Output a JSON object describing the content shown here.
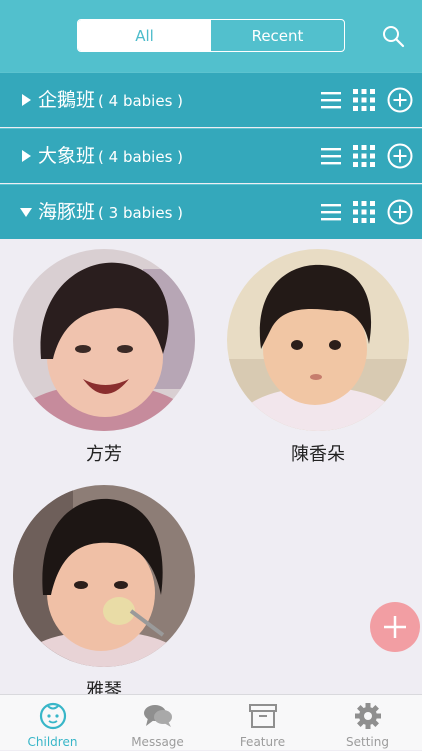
{
  "header": {
    "segments": {
      "all": "All",
      "recent": "Recent"
    },
    "active_segment": "All"
  },
  "groups": [
    {
      "name": "企鵝班",
      "count": "( 4 babies )",
      "expanded": false
    },
    {
      "name": "大象班",
      "count": "( 4 babies )",
      "expanded": false
    },
    {
      "name": "海豚班",
      "count": "( 3 babies )",
      "expanded": true
    }
  ],
  "children": [
    {
      "name": "方芳"
    },
    {
      "name": "陳香朵"
    },
    {
      "name": "雅琴"
    }
  ],
  "tabbar": {
    "children": "Children",
    "message": "Message",
    "feature": "Feature",
    "setting": "Setting",
    "active": "Children"
  },
  "colors": {
    "header": "#52c0cd",
    "group_row": "#34a8bb",
    "accent": "#38b6c8",
    "fab": "#f29ea3",
    "background": "#efedf3"
  },
  "icons": [
    "search-icon",
    "list-icon",
    "grid-icon",
    "add-circle-icon",
    "baby-face-icon",
    "chat-bubbles-icon",
    "archive-box-icon",
    "gear-icon",
    "plus-icon"
  ]
}
